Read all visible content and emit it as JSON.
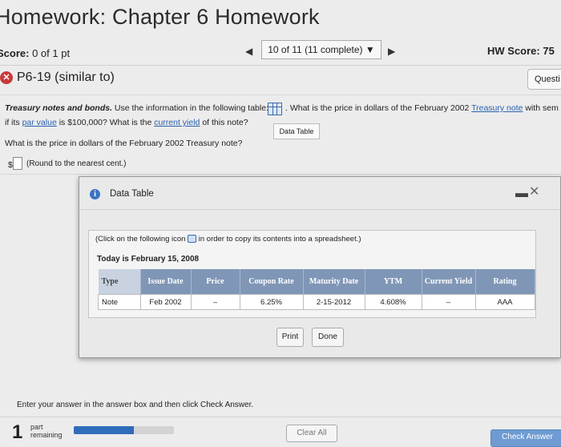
{
  "header": {
    "title": "Homework: Chapter 6 Homework",
    "score_label": "Score:",
    "score_value": "0 of 1 pt",
    "question_selector": "10 of 11 (11 complete) ▼",
    "hw_score": "HW Score: 75"
  },
  "question": {
    "name": "P6-19 (similar to)",
    "info_button": "Questi",
    "heading": "Treasury notes and bonds.",
    "text_a": " Use the information in the following table: ",
    "text_b": ". What is the price in dollars of the February 2002 ",
    "link_treasury": "Treasury note",
    "text_c": " with sem",
    "text_d": "if its ",
    "link_par": "par value",
    "text_e": " is $100,000? What is the ",
    "link_yield": "current yield",
    "text_f": " of this note?",
    "data_table_link": "Data Table",
    "prompt": "What is the price in dollars of the February 2002 Treasury note?",
    "dollar": "$",
    "round_note": "(Round to the nearest cent.)"
  },
  "modal": {
    "title": "Data Table",
    "copy_note_a": "(Click on the following icon ",
    "copy_note_b": " in order to copy its contents into a spreadsheet.)",
    "today": "Today is February 15, 2008",
    "columns": [
      "Type",
      "Issue Date",
      "Price",
      "Coupon Rate",
      "Maturity Date",
      "YTM",
      "Current Yield",
      "Rating"
    ],
    "row": [
      "Note",
      "Feb 2002",
      "–",
      "6.25%",
      "2-15-2012",
      "4.608%",
      "–",
      "AAA"
    ],
    "print": "Print",
    "done": "Done"
  },
  "footer": {
    "instruction": "Enter your answer in the answer box and then click Check Answer.",
    "parts_count": "1",
    "parts_label_1": "part",
    "parts_label_2": "remaining",
    "progress": 0.6,
    "clear_all": "Clear All",
    "check_answer": "Check Answer"
  }
}
